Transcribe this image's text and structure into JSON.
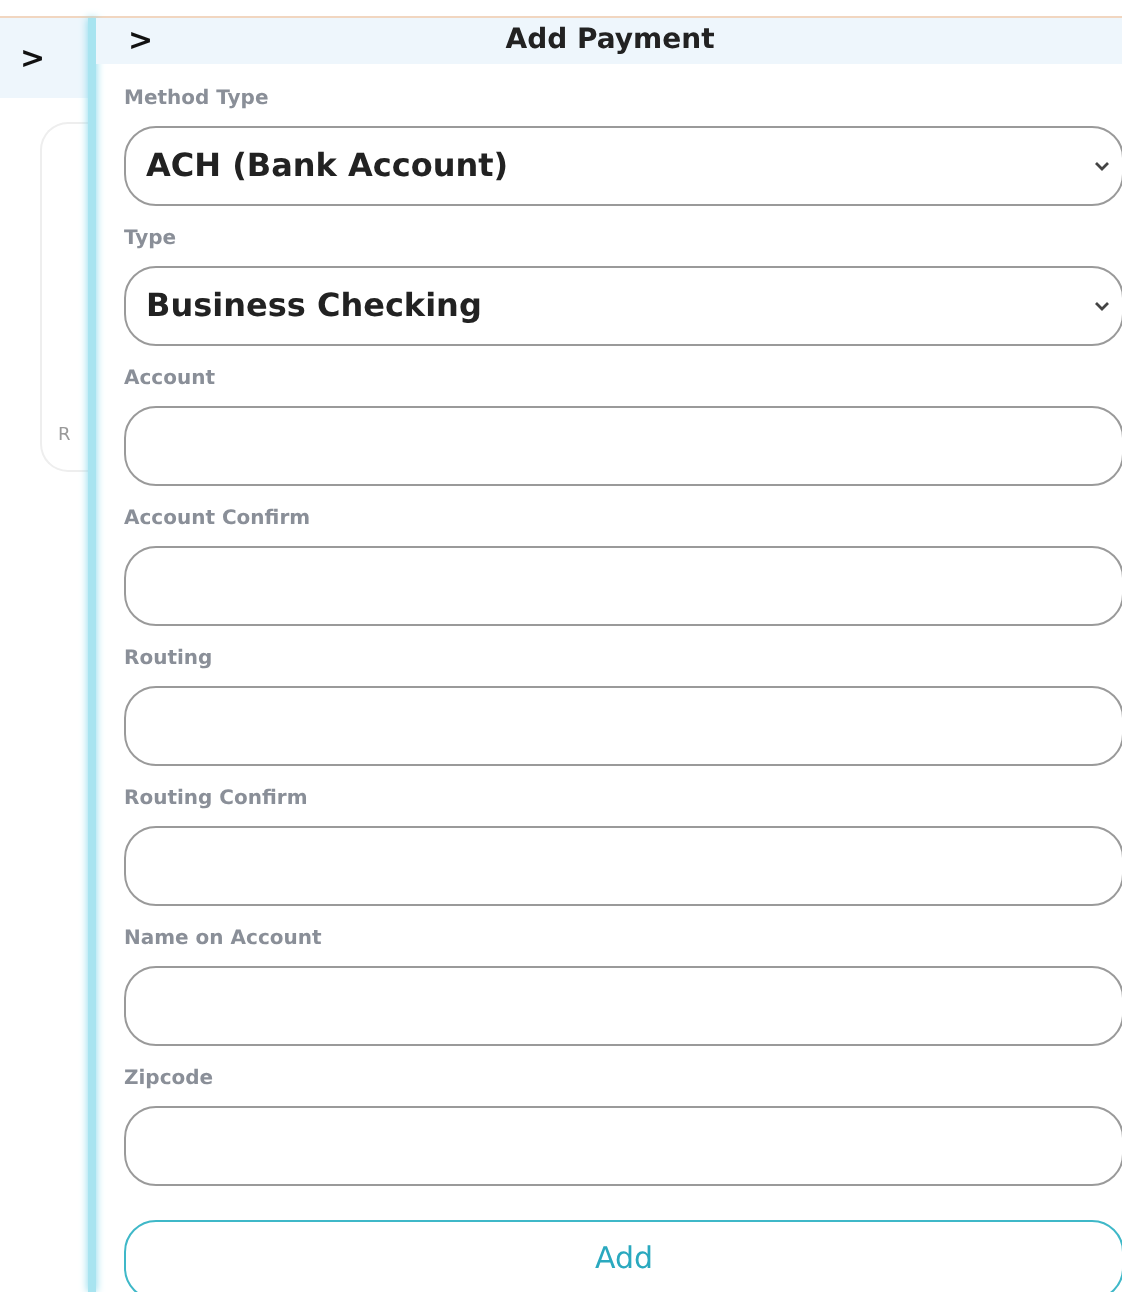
{
  "outer_header": {
    "toggle": ">"
  },
  "background_card": {
    "label": "R"
  },
  "panel": {
    "toggle": ">",
    "title": "Add Payment"
  },
  "fields": [
    {
      "kind": "select",
      "label": "Method Type",
      "value": "ACH (Bank Account)"
    },
    {
      "kind": "select",
      "label": "Type",
      "value": "Business Checking"
    },
    {
      "kind": "input",
      "label": "Account"
    },
    {
      "kind": "input",
      "label": "Account Confirm"
    },
    {
      "kind": "input",
      "label": "Routing"
    },
    {
      "kind": "input",
      "label": "Routing Confirm"
    },
    {
      "kind": "input",
      "label": "Name on Account"
    },
    {
      "kind": "input",
      "label": "Zipcode"
    }
  ],
  "submit": "Add"
}
